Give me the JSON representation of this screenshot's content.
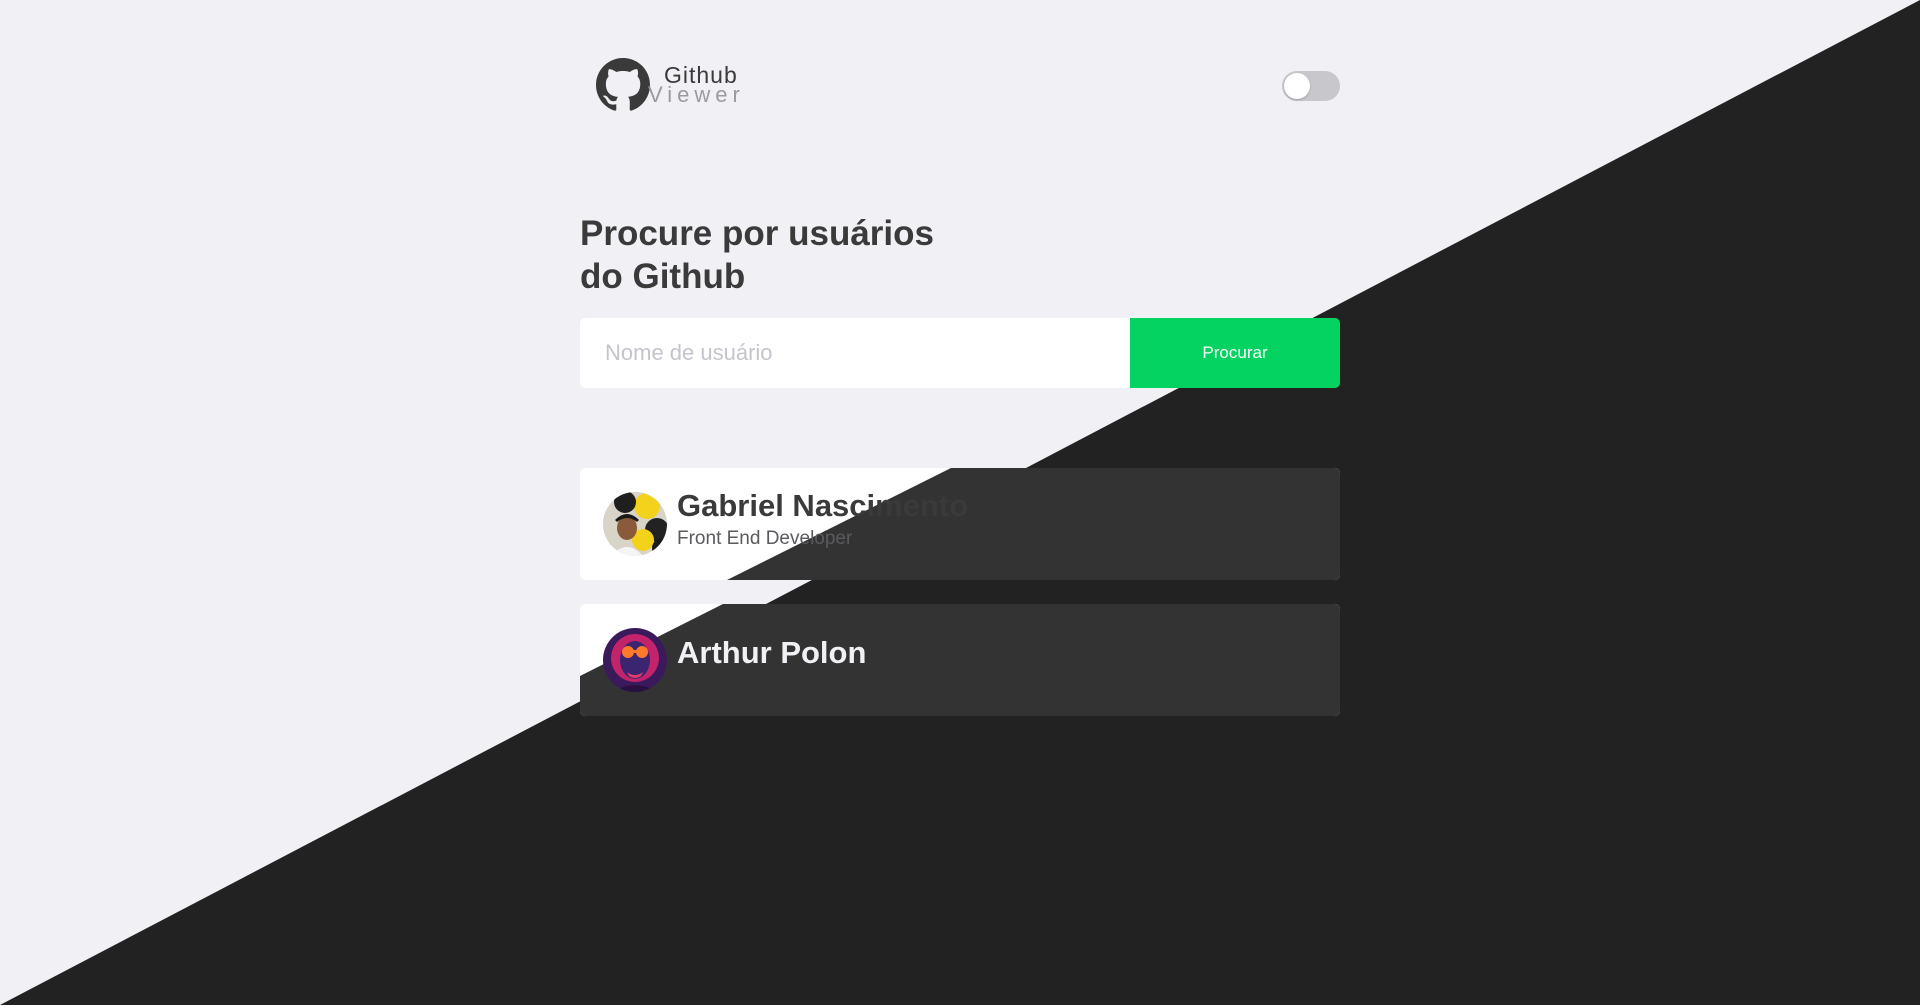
{
  "header": {
    "logo_title": "Github",
    "logo_subtitle": "Viewer",
    "theme_toggle": {
      "enabled": false
    }
  },
  "main": {
    "title_line1": "Procure por usuários",
    "title_line2": "do Github",
    "search": {
      "placeholder": "Nome de usuário",
      "value": "",
      "button_label": "Procurar"
    },
    "users": [
      {
        "name": "Gabriel Nascimento",
        "bio": "Front End Developer"
      },
      {
        "name": "Arthur Polon",
        "bio": ""
      }
    ]
  },
  "colors": {
    "light_bg": "#f0f0f5",
    "dark_bg": "#222222",
    "accent": "#04d361",
    "text": "#3a3a3a"
  }
}
